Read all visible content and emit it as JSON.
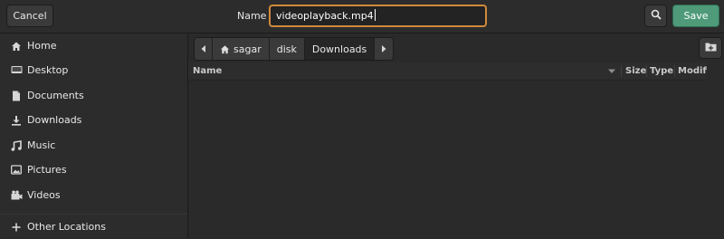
{
  "header": {
    "cancel_label": "Cancel",
    "name_label": "Name",
    "filename_value": "videoplayback.mp4",
    "search_icon": "search-icon",
    "save_label": "Save"
  },
  "sidebar": {
    "items": [
      {
        "label": "Home",
        "icon": "home-icon"
      },
      {
        "label": "Desktop",
        "icon": "desktop-icon"
      },
      {
        "label": "Documents",
        "icon": "document-icon"
      },
      {
        "label": "Downloads",
        "icon": "download-icon"
      },
      {
        "label": "Music",
        "icon": "music-icon"
      },
      {
        "label": "Pictures",
        "icon": "pictures-icon"
      },
      {
        "label": "Videos",
        "icon": "videos-icon"
      },
      {
        "label": "Other Locations",
        "icon": "plus-icon"
      }
    ]
  },
  "pathbar": {
    "crumbs": [
      "sagar",
      "disk",
      "Downloads"
    ],
    "active": "Downloads"
  },
  "columns": {
    "name": "Name",
    "size": "Size",
    "type": "Type",
    "modified": "Modified"
  },
  "colors": {
    "accent_focus": "#d08a3a",
    "save_button": "#4e9a79"
  }
}
